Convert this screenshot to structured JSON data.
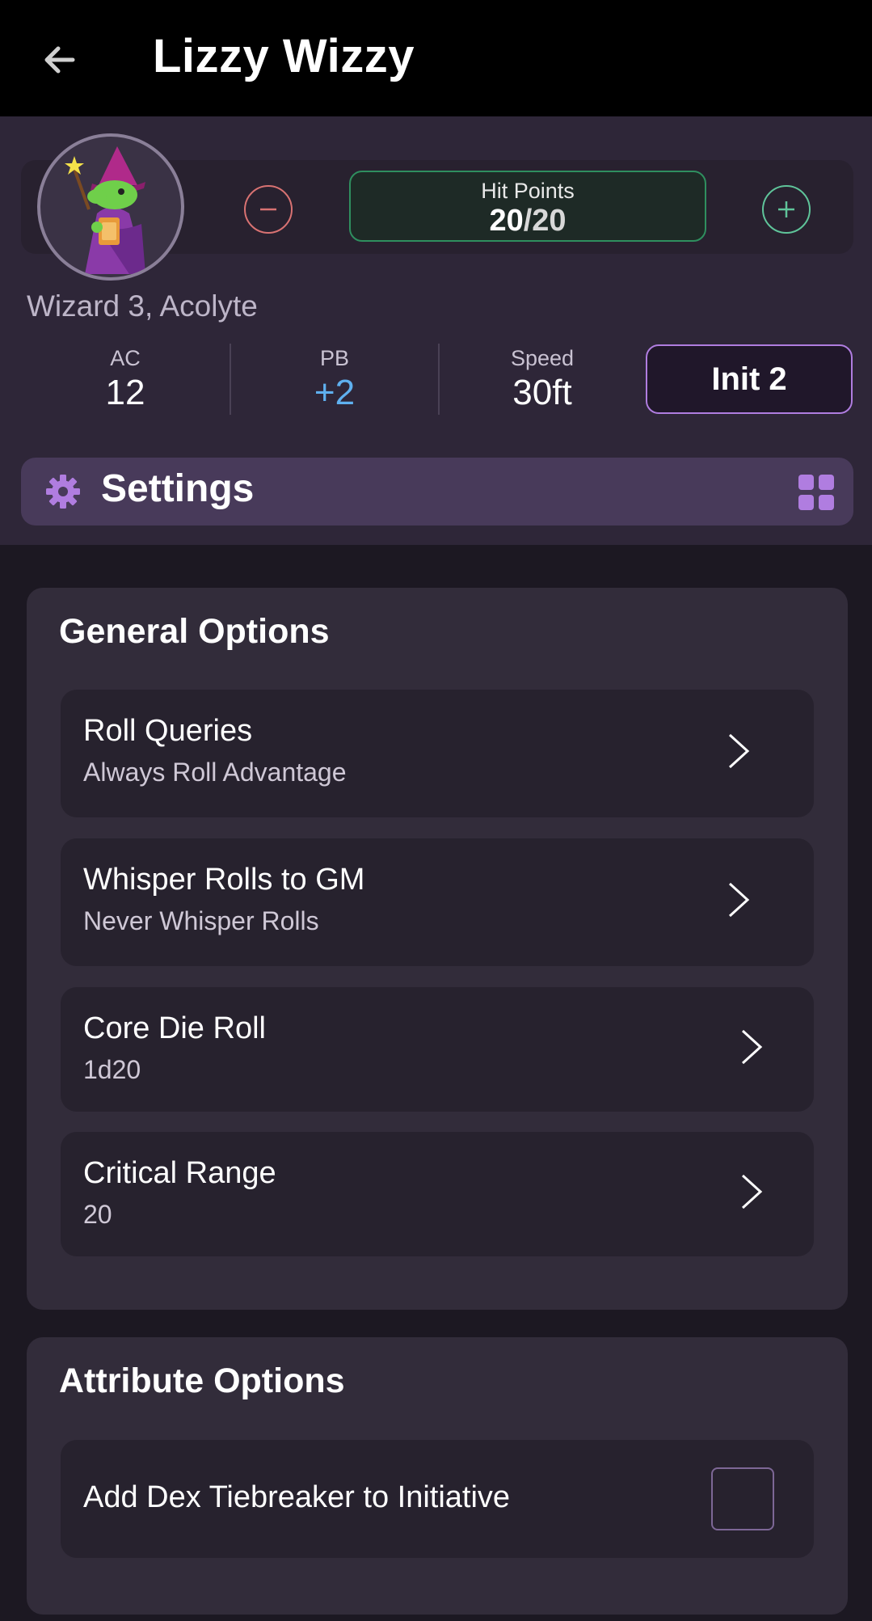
{
  "app_bar": {
    "title": "Lizzy Wizzy",
    "back_icon": "arrow-left-icon"
  },
  "character": {
    "class_line": "Wizard 3, Acolyte",
    "hit_points": {
      "label": "Hit Points",
      "current": "20",
      "separator": "/",
      "max": "20"
    },
    "stats": {
      "ac": {
        "label": "AC",
        "value": "12"
      },
      "pb": {
        "label": "PB",
        "value": "+2"
      },
      "speed": {
        "label": "Speed",
        "value": "30ft"
      }
    },
    "init_label": "Init 2"
  },
  "section": {
    "title": "Settings",
    "icon": "gear-icon",
    "menu_icon": "grid-icon"
  },
  "general": {
    "title": "General Options",
    "items": [
      {
        "title": "Roll Queries",
        "subtitle": "Always Roll Advantage"
      },
      {
        "title": "Whisper Rolls to GM",
        "subtitle": "Never Whisper Rolls"
      },
      {
        "title": "Core Die Roll",
        "subtitle": "1d20"
      },
      {
        "title": "Critical Range",
        "subtitle": "20"
      }
    ]
  },
  "attributes": {
    "title": "Attribute Options",
    "items": [
      {
        "label": "Add Dex Tiebreaker to Initiative",
        "checked": false
      }
    ]
  },
  "colors": {
    "accent": "#b07de0",
    "hp_border": "#2f8f5f",
    "minus": "#d87272",
    "plus": "#5fc49a",
    "pb_value": "#5fb0ef"
  }
}
